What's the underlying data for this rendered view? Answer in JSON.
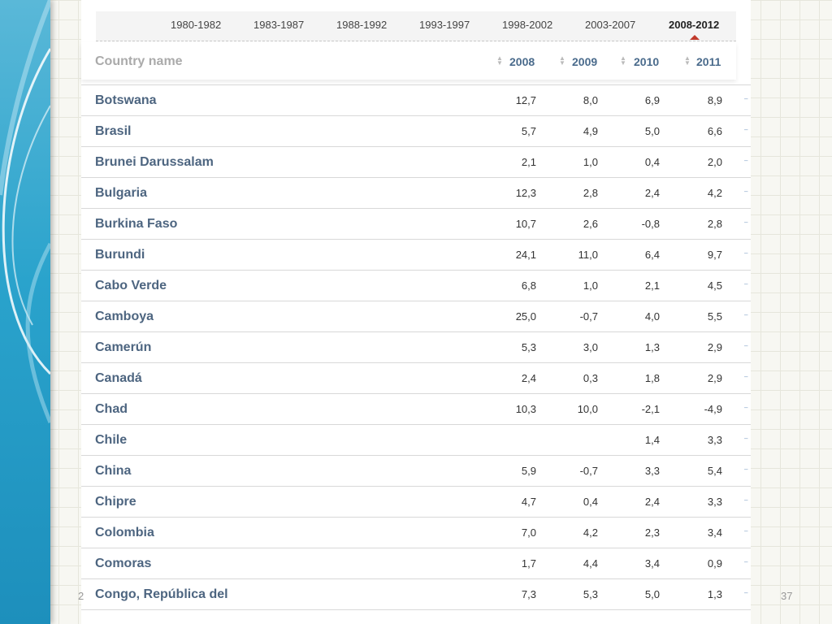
{
  "periods": [
    "1980-1982",
    "1983-1987",
    "1988-1992",
    "1993-1997",
    "1998-2002",
    "2003-2007",
    "2008-2012"
  ],
  "active_period": "2008-2012",
  "header": {
    "country_label": "Country name",
    "years": [
      "2008",
      "2009",
      "2010",
      "2011"
    ],
    "sort_icon": "sort-icon"
  },
  "rows": [
    {
      "country": "Botswana",
      "values": [
        "12,7",
        "8,0",
        "6,9",
        "8,9"
      ]
    },
    {
      "country": "Brasil",
      "values": [
        "5,7",
        "4,9",
        "5,0",
        "6,6"
      ]
    },
    {
      "country": "Brunei Darussalam",
      "values": [
        "2,1",
        "1,0",
        "0,4",
        "2,0"
      ]
    },
    {
      "country": "Bulgaria",
      "values": [
        "12,3",
        "2,8",
        "2,4",
        "4,2"
      ]
    },
    {
      "country": "Burkina Faso",
      "values": [
        "10,7",
        "2,6",
        "-0,8",
        "2,8"
      ]
    },
    {
      "country": "Burundi",
      "values": [
        "24,1",
        "11,0",
        "6,4",
        "9,7"
      ]
    },
    {
      "country": "Cabo Verde",
      "values": [
        "6,8",
        "1,0",
        "2,1",
        "4,5"
      ]
    },
    {
      "country": "Camboya",
      "values": [
        "25,0",
        "-0,7",
        "4,0",
        "5,5"
      ]
    },
    {
      "country": "Camerún",
      "values": [
        "5,3",
        "3,0",
        "1,3",
        "2,9"
      ]
    },
    {
      "country": "Canadá",
      "values": [
        "2,4",
        "0,3",
        "1,8",
        "2,9"
      ]
    },
    {
      "country": "Chad",
      "values": [
        "10,3",
        "10,0",
        "-2,1",
        "-4,9"
      ]
    },
    {
      "country": "Chile",
      "values": [
        "",
        "",
        "1,4",
        "3,3"
      ]
    },
    {
      "country": "China",
      "values": [
        "5,9",
        "-0,7",
        "3,3",
        "5,4"
      ]
    },
    {
      "country": "Chipre",
      "values": [
        "4,7",
        "0,4",
        "2,4",
        "3,3"
      ]
    },
    {
      "country": "Colombia",
      "values": [
        "7,0",
        "4,2",
        "2,3",
        "3,4"
      ]
    },
    {
      "country": "Comoras",
      "values": [
        "1,7",
        "4,4",
        "3,4",
        "0,9"
      ]
    },
    {
      "country": "Congo, República del",
      "values": [
        "7,3",
        "5,3",
        "5,0",
        "1,3"
      ]
    }
  ],
  "trend_icon": "sparkline-icon",
  "slide_number": "37",
  "slide_number_left": "2",
  "colors": {
    "accent_blue": "#2aa3cc",
    "country_text": "#4d6580",
    "active_marker": "#c0392b"
  }
}
